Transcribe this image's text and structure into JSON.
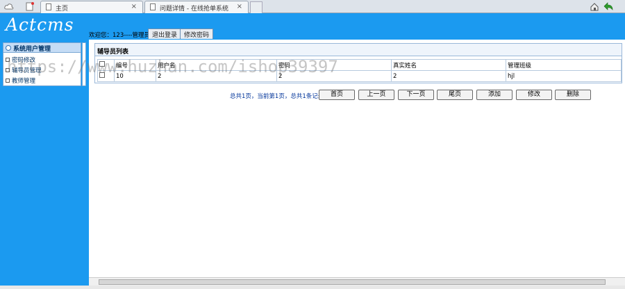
{
  "browser": {
    "tabs": [
      {
        "title": "主页",
        "close": "×"
      },
      {
        "title": "问题详情 - 在线抢单系统",
        "close": "×"
      }
    ]
  },
  "header": {
    "logo": "Actcms",
    "welcome": "欢迎您：123----管理员",
    "logout_label": "退出登录",
    "change_password_label": "修改密码"
  },
  "sidebar": {
    "title": "系统用户管理",
    "items": [
      {
        "label": "密码修改"
      },
      {
        "label": "辅导员管理"
      },
      {
        "label": "教师管理"
      }
    ]
  },
  "main": {
    "panel_title": "辅导员列表",
    "columns": [
      "编号",
      "用户名",
      "密码",
      "真实姓名",
      "管理班级"
    ],
    "rows": [
      {
        "id": "10",
        "username": "2",
        "password": "2",
        "realname": "2",
        "class": "hjl"
      }
    ],
    "pager_text": "总共1页，当前第1页，总共1条记录",
    "buttons": {
      "first": "首页",
      "prev": "上一页",
      "next": "下一页",
      "last": "尾页",
      "add": "添加",
      "edit": "修改",
      "delete": "删除"
    }
  },
  "watermark": "https://www.huzhan.com/ishop39397",
  "colors": {
    "header_bg": "#1b9af0",
    "panel_border": "#9ab8d9",
    "menu_text": "#003366"
  }
}
